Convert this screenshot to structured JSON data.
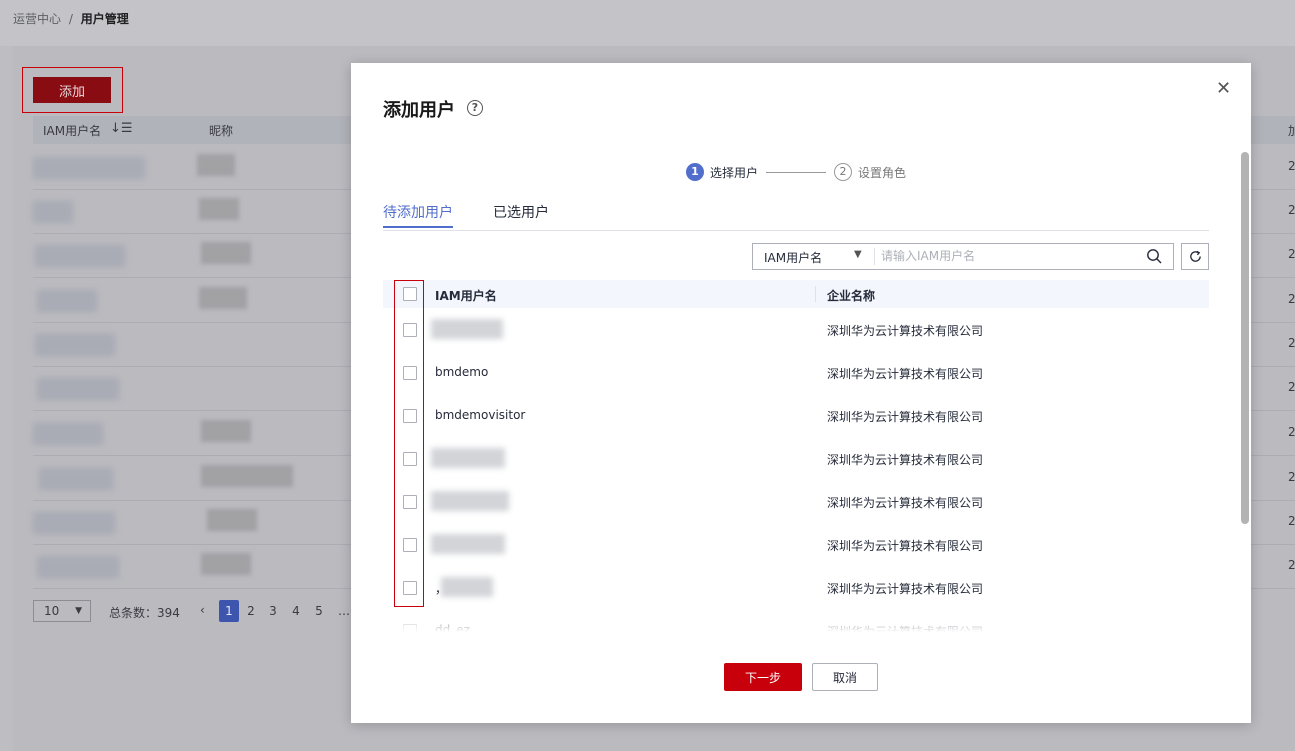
{
  "breadcrumb": {
    "parent": "运营中心",
    "separator": "/",
    "current": "用户管理"
  },
  "background": {
    "add_label": "添加",
    "table": {
      "columns": [
        "IAM用户名",
        "昵称"
      ],
      "right_header": "加",
      "right_values": [
        "2",
        "2",
        "2",
        "2",
        "2",
        "2",
        "2",
        "2",
        "2",
        "2"
      ]
    },
    "pagination": {
      "page_size": "10",
      "total_label": "总条数：394",
      "pages": [
        "1",
        "2",
        "3",
        "4",
        "5"
      ],
      "current_page": "1",
      "ellipsis": "…"
    }
  },
  "modal": {
    "title": "添加用户",
    "help_icon": "help-icon",
    "close_icon": "close-icon",
    "steps": [
      {
        "number": "1",
        "label": "选择用户"
      },
      {
        "number": "2",
        "label": "设置角色"
      }
    ],
    "tabs": [
      {
        "label": "待添加用户",
        "active": true
      },
      {
        "label": "已选用户",
        "active": false
      }
    ],
    "filter": {
      "field": "IAM用户名",
      "placeholder": "请输入IAM用户名"
    },
    "table": {
      "columns": {
        "name": "IAM用户名",
        "company": "企业名称"
      },
      "rows": [
        {
          "name": "",
          "company": "深圳华为云计算技术有限公司"
        },
        {
          "name": "bmdemo",
          "company": "深圳华为云计算技术有限公司"
        },
        {
          "name": "bmdemovisitor",
          "company": "深圳华为云计算技术有限公司"
        },
        {
          "name": "",
          "company": "深圳华为云计算技术有限公司"
        },
        {
          "name": "",
          "company": "深圳华为云计算技术有限公司"
        },
        {
          "name": "",
          "company": "深圳华为云计算技术有限公司"
        },
        {
          "name": "，",
          "company": "深圳华为云计算技术有限公司"
        },
        {
          "name": "dd_ez",
          "company": "深圳华为云计算技术有限公司"
        }
      ]
    },
    "next_label": "下一步",
    "cancel_label": "取消"
  },
  "colors": {
    "primary_red": "#c7000b",
    "accent_blue": "#526ecc"
  }
}
